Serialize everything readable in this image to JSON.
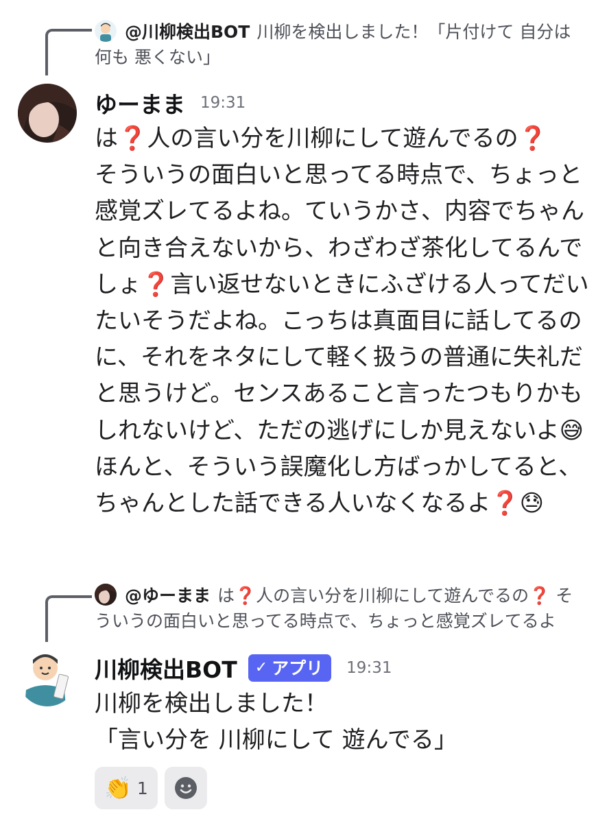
{
  "messages": [
    {
      "reply": {
        "author": "@川柳検出BOT",
        "text": "川柳を検出しました！「片付けて 自分は 何も 悪くない」"
      },
      "author": "ゆーまま",
      "time": "19:31",
      "body": [
        "は",
        "❓",
        "人の言い分を川柳にして遊んでるの",
        "❓",
        "\nそういうの面白いと思ってる時点で、ちょっと感覚ズレてるよね。ていうかさ、内容でちゃんと向き合えないから、わざわざ茶化してるんでしょ",
        "❓",
        "言い返せないときにふざける人ってだいたいそうだよね。こっちは真面目に話してるのに、それをネタにして軽く扱うの普通に失礼だと思うけど。センスあること言ったつもりかもしれないけど、ただの逃げにしか見えないよ",
        "😅",
        "ほんと、そういう誤魔化し方ばっかしてると、ちゃんとした話できる人いなくなるよ",
        "❓",
        "😓"
      ]
    },
    {
      "reply": {
        "author": "@ゆーまま",
        "text": "は❓人の言い分を川柳にして遊んでるの❓ そういうの面白いと思ってる時点で、ちょっと感覚ズレてるよ"
      },
      "author": "川柳検出BOT",
      "badge": "アプリ",
      "time": "19:31",
      "line1": "川柳を検出しました！",
      "line2": "「言い分を 川柳にして 遊んでる」"
    }
  ],
  "reactions": [
    {
      "icon": "clapping-hands-icon",
      "emoji": "👏",
      "count": "1"
    },
    {
      "icon": "add-reaction-icon"
    }
  ]
}
